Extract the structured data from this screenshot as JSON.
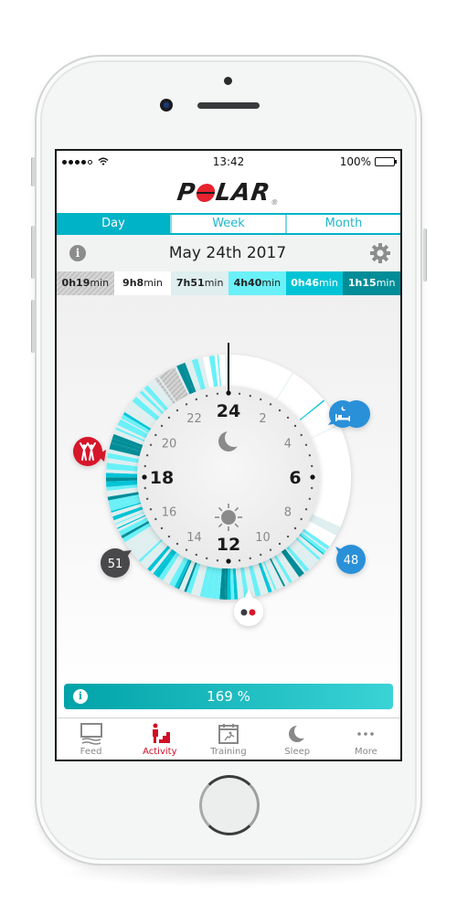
{
  "status_bar": {
    "time": "13:42",
    "battery": "100%",
    "signal_bars": 4,
    "signal_max": 5,
    "wifi_icon": "wifi-icon",
    "battery_icon": "battery-full-icon"
  },
  "header": {
    "brand": "POLAR",
    "brand_letters": [
      "P",
      "L",
      "A",
      "R"
    ],
    "registered_mark": "®"
  },
  "tabs": [
    {
      "label": "Day",
      "active": true
    },
    {
      "label": "Week",
      "active": false
    },
    {
      "label": "Month",
      "active": false
    }
  ],
  "date_bar": {
    "info_icon": "i",
    "date": "May 24th 2017",
    "settings_icon": "⚙"
  },
  "zones": [
    {
      "hours": "0h",
      "minutes": "19",
      "unit": "min",
      "level": "inactivity"
    },
    {
      "hours": "9h",
      "minutes": "8",
      "unit": "min",
      "level": "rest"
    },
    {
      "hours": "7h",
      "minutes": "51",
      "unit": "min",
      "level": "sitting"
    },
    {
      "hours": "4h",
      "minutes": "40",
      "unit": "min",
      "level": "low"
    },
    {
      "hours": "0h",
      "minutes": "46",
      "unit": "min",
      "level": "medium"
    },
    {
      "hours": "1h",
      "minutes": "15",
      "unit": "min",
      "level": "high"
    }
  ],
  "dial": {
    "major_labels": [
      "24",
      "6",
      "12",
      "18"
    ],
    "minor_labels": [
      "2",
      "4",
      "8",
      "10",
      "14",
      "16",
      "20",
      "22"
    ],
    "night_icon": "moon-icon",
    "day_icon": "sun-icon",
    "markers": [
      {
        "type": "sleep",
        "icon": "bed-icon",
        "color": "#2a90d8"
      },
      {
        "type": "steps-start",
        "value": "48",
        "color": "#2a90d8"
      },
      {
        "type": "training",
        "icon": "training-dots-icon"
      },
      {
        "type": "steps-end",
        "value": "51",
        "color": "#4a4a4c"
      },
      {
        "type": "activity-event",
        "icon": "people-cheer-icon",
        "color": "#d6162a"
      }
    ],
    "colors": {
      "rest": "#ffffff",
      "sitting": "#dfeeef",
      "low": "#6af0f7",
      "medium": "#00c4d6",
      "high": "#008d98",
      "inactivity": "#c8c8c8"
    }
  },
  "goal": {
    "info_icon": "i",
    "percent": "169 %",
    "fraction": 1.69
  },
  "nav": [
    {
      "label": "Feed",
      "icon": "feed-icon",
      "active": false
    },
    {
      "label": "Activity",
      "icon": "activity-icon",
      "active": true
    },
    {
      "label": "Training",
      "icon": "training-calendar-icon",
      "active": false
    },
    {
      "label": "Sleep",
      "icon": "moon-icon",
      "active": false
    },
    {
      "label": "More",
      "icon": "more-dots-icon",
      "active": false
    }
  ]
}
